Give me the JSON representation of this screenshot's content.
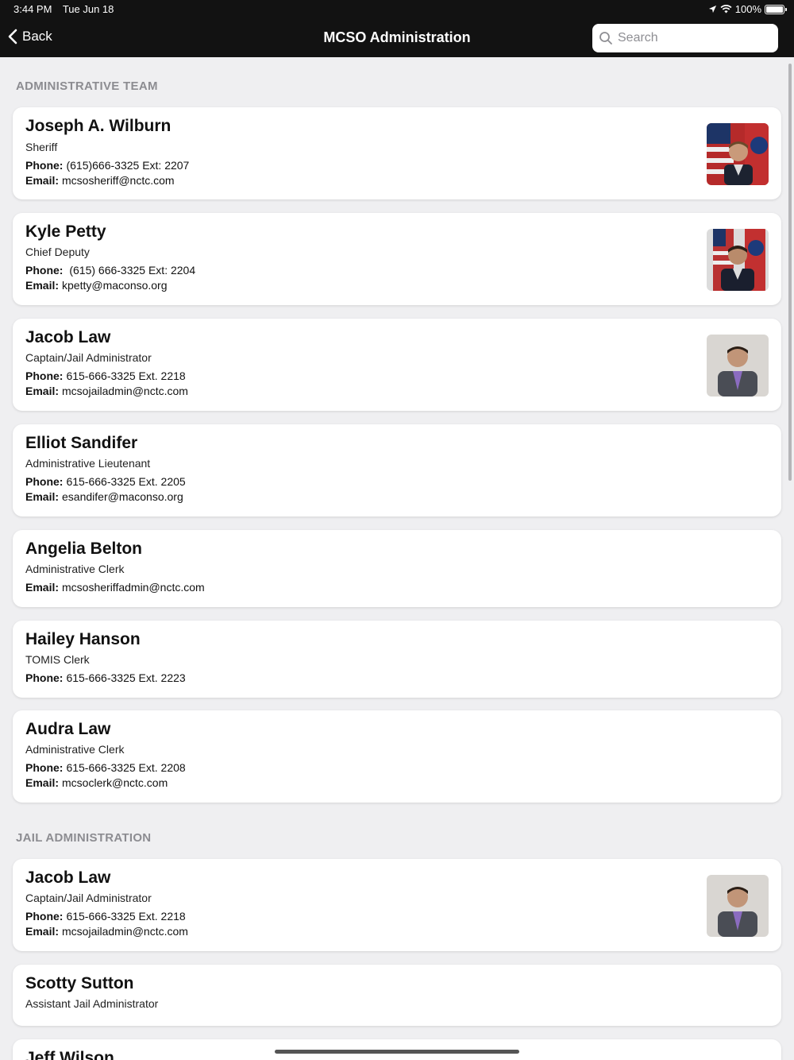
{
  "status_bar": {
    "time": "3:44 PM",
    "date": "Tue Jun 18",
    "battery": "100%"
  },
  "nav": {
    "back_label": "Back",
    "title": "MCSO Administration",
    "search_placeholder": "Search"
  },
  "sections": [
    {
      "header": "ADMINISTRATIVE TEAM"
    },
    {
      "header": "JAIL ADMINISTRATION"
    }
  ],
  "labels": {
    "phone": "Phone:",
    "email": "Email:"
  },
  "cards": [
    {
      "name": "Joseph A. Wilburn",
      "title": "Sheriff",
      "phone": "(615)666-3325 Ext: 2207",
      "email": "mcsosheriff@nctc.com",
      "photo": "flags-portrait"
    },
    {
      "name": "Kyle Petty",
      "title": "Chief Deputy",
      "phone": " (615) 666-3325 Ext: 2204",
      "email": "kpetty@maconso.org",
      "photo": "flags-portrait"
    },
    {
      "name": "Jacob Law",
      "title": "Captain/Jail Administrator",
      "phone": "615-666-3325 Ext. 2218",
      "email": "mcsojailadmin@nctc.com",
      "photo": "plain-portrait"
    },
    {
      "name": "Elliot Sandifer",
      "title": "Administrative Lieutenant",
      "phone": "615-666-3325 Ext. 2205",
      "email": "esandifer@maconso.org"
    },
    {
      "name": "Angelia Belton",
      "title": "Administrative Clerk",
      "email": "mcsosheriffadmin@nctc.com"
    },
    {
      "name": "Hailey Hanson",
      "title": "TOMIS Clerk",
      "phone": "615-666-3325 Ext. 2223"
    },
    {
      "name": "Audra Law",
      "title": "Administrative Clerk",
      "phone": "615-666-3325 Ext. 2208",
      "email": "mcsoclerk@nctc.com"
    },
    {
      "name": "Jacob Law",
      "title": "Captain/Jail Administrator",
      "phone": "615-666-3325 Ext. 2218",
      "email": "mcsojailadmin@nctc.com",
      "photo": "plain-portrait"
    },
    {
      "name": "Scotty Sutton",
      "title": "Assistant Jail Administrator"
    },
    {
      "name": "Jeff Wilson"
    }
  ]
}
